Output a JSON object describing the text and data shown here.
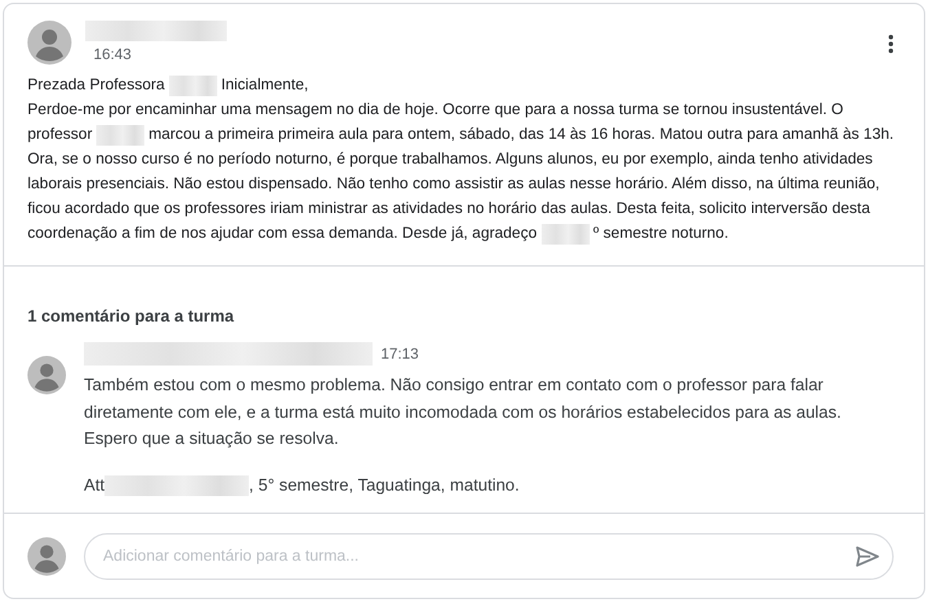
{
  "post": {
    "time": "16:43",
    "body": [
      [
        {
          "kind": "text",
          "text": "Prezada Professora"
        },
        {
          "kind": "redacted"
        },
        {
          "kind": "text",
          "text": "Inicialmente,"
        }
      ],
      [
        {
          "kind": "text",
          "text": "Perdoe-me por encaminhar uma mensagem no dia de hoje. Ocorre que para a nossa turma se tornou insustentável. O"
        }
      ],
      [
        {
          "kind": "text",
          "text": "professor"
        },
        {
          "kind": "redacted"
        },
        {
          "kind": "text",
          "text": "marcou a primeira primeira aula para ontem, sábado, das 14 às 16 horas. Matou outra para amanhã às 13h."
        }
      ],
      [
        {
          "kind": "text",
          "text": "Ora, se o nosso curso é no período noturno, é porque trabalhamos. Alguns alunos, eu por exemplo, ainda tenho atividades"
        }
      ],
      [
        {
          "kind": "text",
          "text": "laborais presenciais. Não estou dispensado. Não tenho como assistir as aulas nesse horário. Além disso, na última reunião,"
        }
      ],
      [
        {
          "kind": "text",
          "text": "ficou acordado que os professores iriam ministrar as atividades no horário das aulas. Desta feita, solicito interversão desta"
        }
      ],
      [
        {
          "kind": "text",
          "text": "coordenação a fim de nos ajudar com essa demanda. Desde já, agradeço"
        },
        {
          "kind": "redacted"
        },
        {
          "kind": "text",
          "text": "º semestre noturno."
        }
      ]
    ]
  },
  "comments_heading": "1 comentário para a turma",
  "comments": [
    {
      "time": "17:13",
      "paragraphs": [
        [
          {
            "kind": "text",
            "text": "Também estou com o mesmo problema. Não consigo entrar em contato com o professor para falar diretamente com ele, e a turma está muito incomodada com os horários estabelecidos para as aulas. Espero que a situação se resolva."
          }
        ],
        [
          {
            "kind": "text",
            "text": "Att"
          },
          {
            "kind": "redacted"
          },
          {
            "kind": "text",
            "text": ", 5° semestre, Taguatinga, matutino."
          }
        ]
      ]
    }
  ],
  "comment_field": {
    "placeholder": "Adicionar comentário para a turma..."
  }
}
